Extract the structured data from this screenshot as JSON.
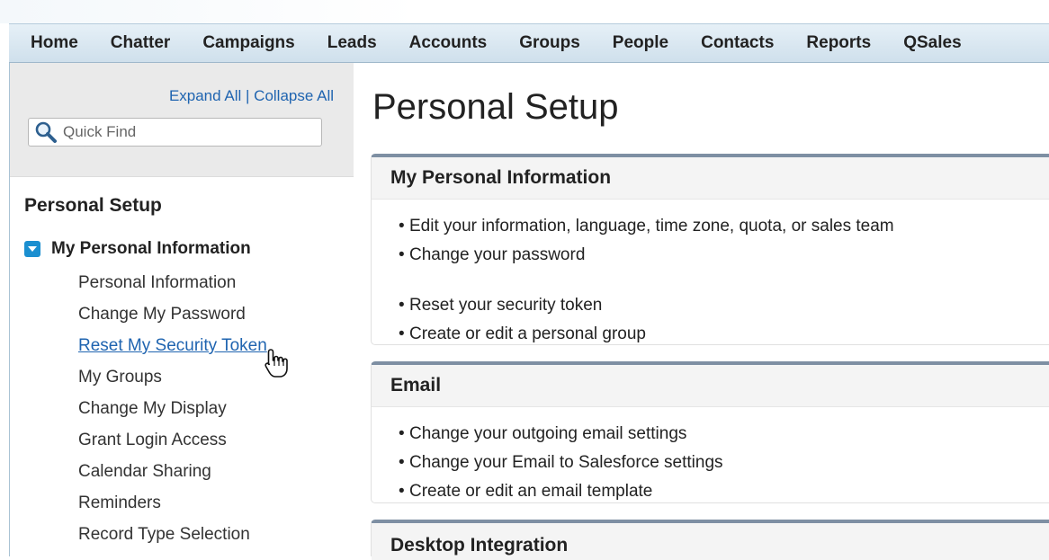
{
  "nav": {
    "tabs": [
      "Home",
      "Chatter",
      "Campaigns",
      "Leads",
      "Accounts",
      "Groups",
      "People",
      "Contacts",
      "Reports",
      "QSales"
    ]
  },
  "sidebar": {
    "expand_all": "Expand All",
    "separator": "|",
    "collapse_all": "Collapse All",
    "quick_find_placeholder": "Quick Find",
    "title": "Personal Setup",
    "section": {
      "label": "My Personal Information",
      "items": [
        "Personal Information",
        "Change My Password",
        "Reset My Security Token",
        "My Groups",
        "Change My Display",
        "Grant Login Access",
        "Calendar Sharing",
        "Reminders",
        "Record Type Selection"
      ],
      "active_item": "Reset My Security Token"
    }
  },
  "main": {
    "title": "Personal Setup",
    "panels": [
      {
        "title": "My Personal Information",
        "items": [
          "Edit your information, language, time zone, quota, or sales team",
          "Change your password",
          "Reset your security token",
          "Create or edit a personal group"
        ]
      },
      {
        "title": "Email",
        "items": [
          "Change your outgoing email settings",
          "Change your Email to Salesforce settings",
          "Create or edit an email template"
        ]
      },
      {
        "title": "Desktop Integration",
        "items": []
      }
    ]
  },
  "colors": {
    "link": "#1f64b0",
    "nav_bg": "#cfe0ec",
    "panel_accent": "#7e8fa3",
    "toggle": "#1b8fd0"
  },
  "icons": {
    "quick_find": "magnifier-icon",
    "section_toggle": "triangle-down-icon",
    "cursor": "hand-pointer-icon"
  }
}
